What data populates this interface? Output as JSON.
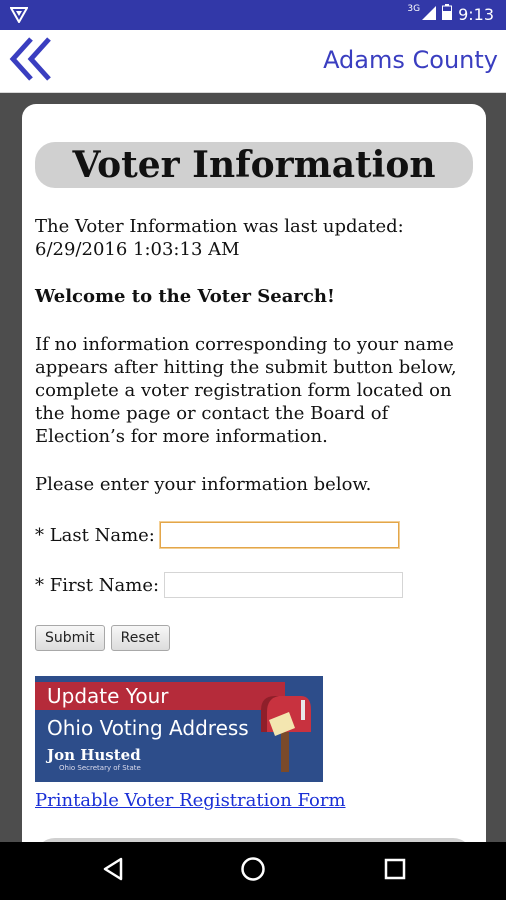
{
  "status_bar": {
    "network": "3G",
    "time": "9:13"
  },
  "app_bar": {
    "title": "Adams County"
  },
  "page": {
    "heading": "Voter Information",
    "updated_line1": "The Voter Information was last updated:",
    "updated_line2": "6/29/2016 1:03:13 AM",
    "welcome": "Welcome to the Voter Search!",
    "instructions": "If no information corresponding to your name appears after hitting the submit button below, complete a voter registration form located on the home page or contact the Board of Election’s for more information.",
    "please": "Please enter your information below.",
    "last_name_label": "* Last Name:",
    "last_name_value": "",
    "first_name_label": "* First Name:",
    "first_name_value": "",
    "submit_label": "Submit",
    "reset_label": "Reset",
    "ad": {
      "line1": "Update Your",
      "line2": "Ohio Voting Address",
      "line3": "Jon Husted",
      "line4": "Ohio Secretary of State"
    },
    "link_text": "Printable Voter Registration Form"
  },
  "colors": {
    "status_bar": "#3238a8",
    "accent": "#3a3ec0",
    "link": "#1a2fd6"
  }
}
